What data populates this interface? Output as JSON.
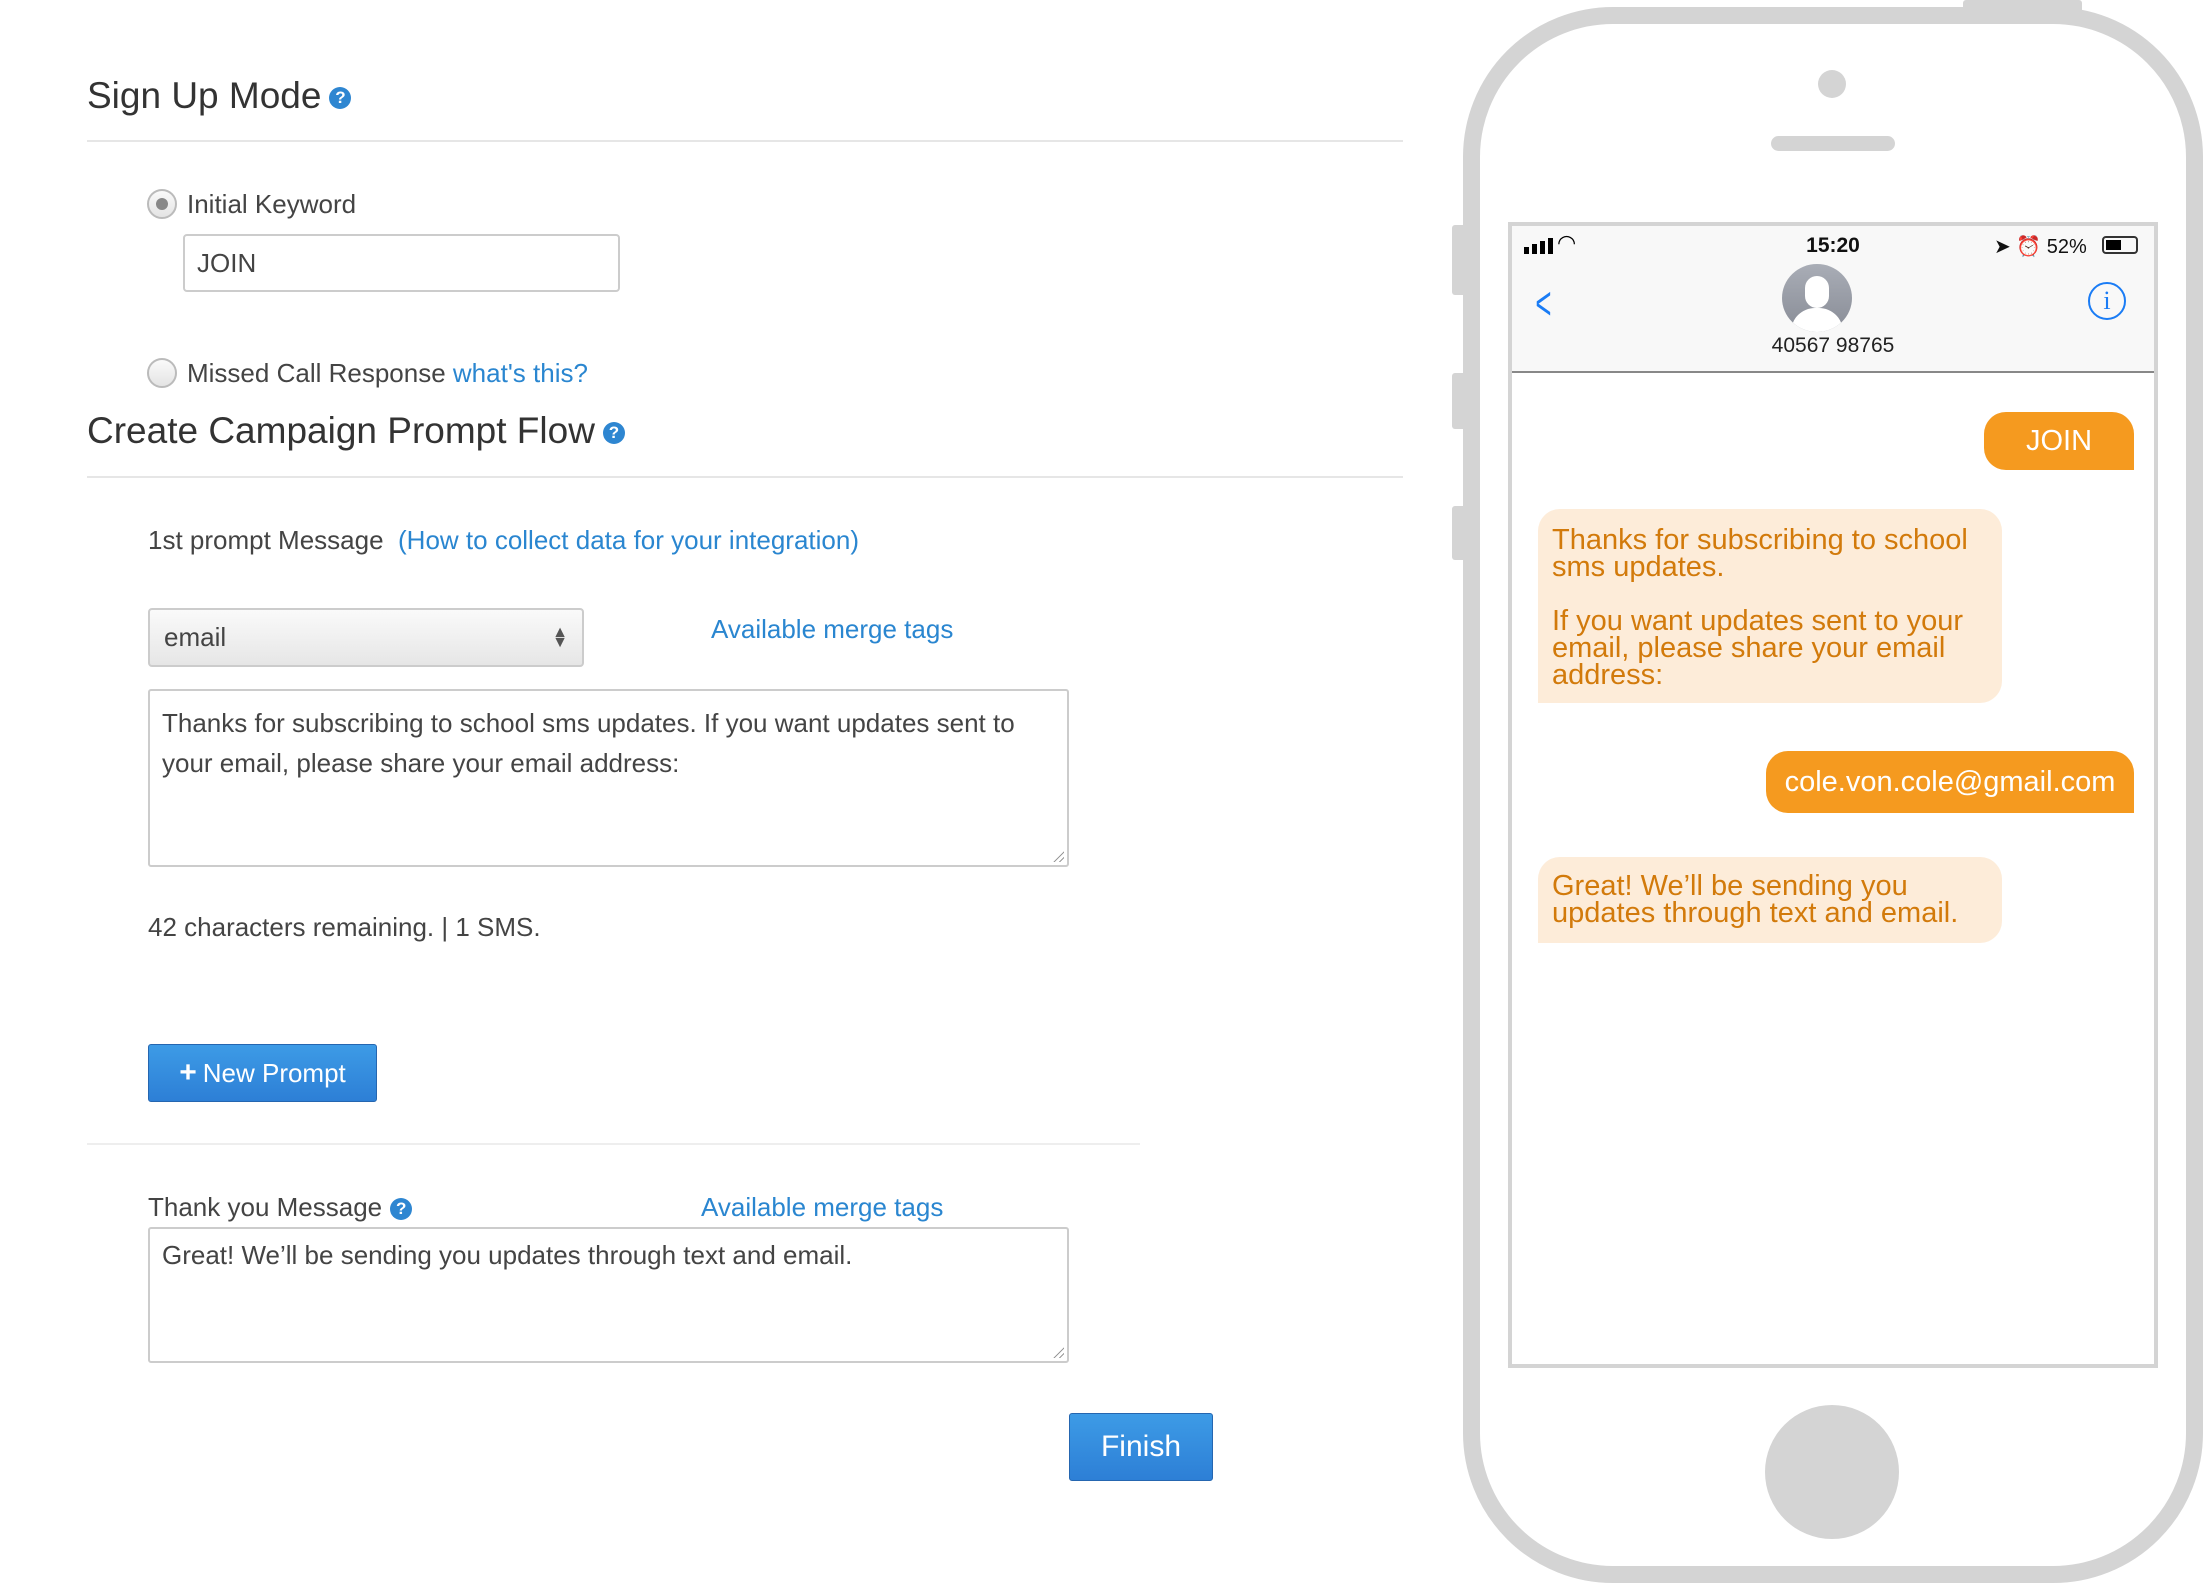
{
  "signup": {
    "title": "Sign Up Mode",
    "options": [
      {
        "label": "Initial Keyword",
        "selected": true
      },
      {
        "label": "Missed Call Response",
        "selected": false
      }
    ],
    "keyword_value": "JOIN",
    "whats_this": "what's this?"
  },
  "flow": {
    "title": "Create Campaign Prompt Flow",
    "prompt_label": "1st prompt Message",
    "prompt_link": "(How to collect data for your integration)",
    "select_value": "email",
    "merge_tags": "Available merge tags",
    "prompt_text": "Thanks for subscribing to school sms updates. If you want updates sent to your email, please share your email address:",
    "chars_remaining": "42 characters remaining. | 1 SMS.",
    "new_prompt": "New Prompt",
    "thank_label": "Thank you Message",
    "thank_merge_tags": "Available merge tags",
    "thank_text": "Great! We’ll be sending you updates through text and email.",
    "finish": "Finish"
  },
  "phone": {
    "time": "15:20",
    "battery": "52%",
    "contact": "40567 98765",
    "messages": [
      {
        "dir": "out",
        "text": "JOIN"
      },
      {
        "dir": "in",
        "lines": [
          "Thanks for subscribing to school",
          "sms updates.",
          "",
          "If you want updates sent to your",
          "email, please share your email",
          "address:"
        ]
      },
      {
        "dir": "out",
        "text": "cole.von.cole@gmail.com"
      },
      {
        "dir": "in",
        "lines": [
          "Great! We’ll be sending you",
          "updates through text and email."
        ]
      }
    ]
  },
  "colors": {
    "accent": "#2a86d0",
    "bubble_out": "#f59a1f",
    "bubble_in": "#fdecd9",
    "bubble_in_text": "#d27a0b"
  }
}
